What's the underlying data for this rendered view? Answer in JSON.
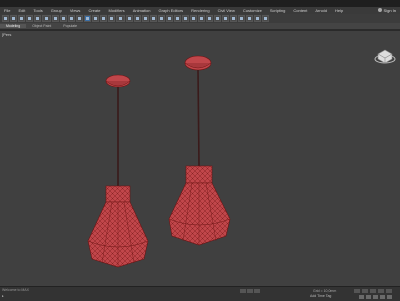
{
  "menu": {
    "items": [
      "File",
      "Edit",
      "Tools",
      "Group",
      "Views",
      "Create",
      "Modifiers",
      "Animation",
      "Graph Editors",
      "Rendering",
      "Civil View",
      "Customize",
      "Scripting",
      "Content",
      "Arnold",
      "Help"
    ],
    "signin": "Sign In"
  },
  "ribbon": {
    "tabs": [
      "Modeling",
      "Object Paint",
      "Populate"
    ]
  },
  "viewport": {
    "label": "[+] [Perspective] [Standard] [Edged Faces]",
    "label_short": "[Pers"
  },
  "status": {
    "welcome": "Welcome to MAX",
    "grid": "Grid = 10,0mm",
    "add_time_tag": "Add Time Tag"
  },
  "colors": {
    "mesh_fill": "#c0464a",
    "mesh_wire": "#6e1414",
    "viewport_bg": "#404040"
  }
}
